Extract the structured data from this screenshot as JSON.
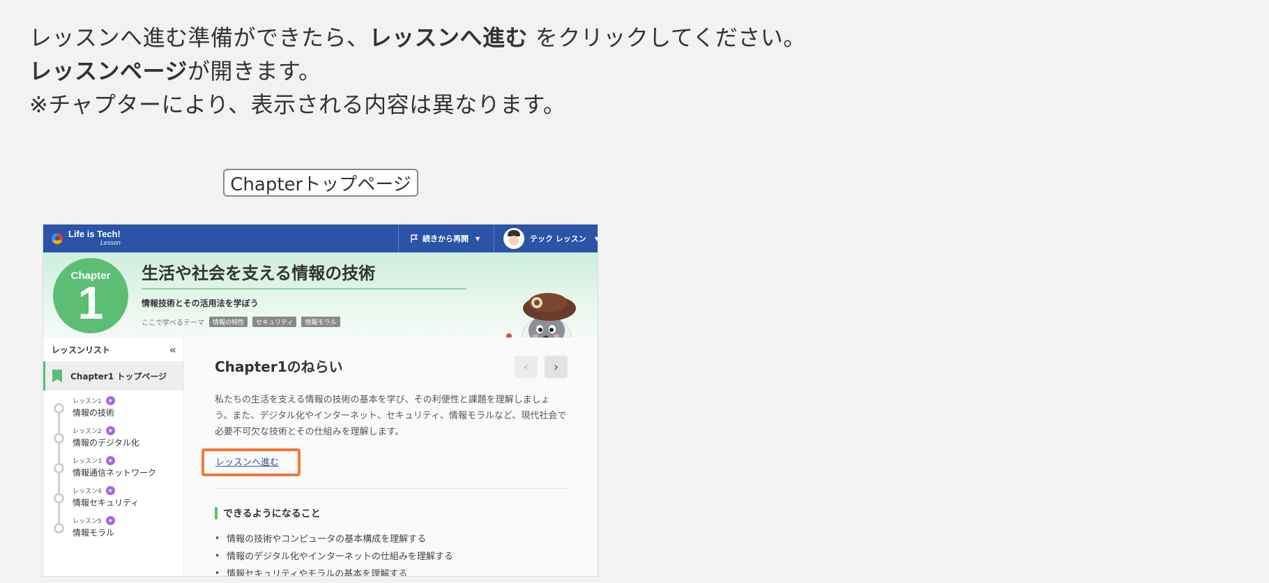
{
  "instructions": {
    "line1_pre": "レッスンへ進む準備ができたら、",
    "line1_bold": "レッスンへ進む",
    "line1_post": " をクリックしてください。",
    "line2_bold": "レッスンページ",
    "line2_post": "が開きます。",
    "line3": "※チャプターにより、表示される内容は異なります。"
  },
  "page_label": "Chapterトップページ",
  "app": {
    "logo_text": "Life is Tech!",
    "logo_sub": "Lesson",
    "resume_label": "続きから再開",
    "user_name": "テック レッスン"
  },
  "banner": {
    "chapter_word": "Chapter",
    "chapter_number": "1",
    "title": "生活や社会を支える情報の技術",
    "subtitle": "情報技術とその活用法を学ぼう",
    "themes_label": "ここで学べるテーマ",
    "themes": [
      "情報の特性",
      "セキュリティ",
      "情報モラル"
    ]
  },
  "sidebar": {
    "title": "レッスンリスト",
    "top_item": "Chapter1 トップページ",
    "lessons": [
      {
        "number": "レッスン1",
        "name": "情報の技術"
      },
      {
        "number": "レッスン2",
        "name": "情報のデジタル化"
      },
      {
        "number": "レッスン3",
        "name": "情報通信ネットワーク"
      },
      {
        "number": "レッスン4",
        "name": "情報セキュリティ"
      },
      {
        "number": "レッスン5",
        "name": "情報モラル"
      }
    ]
  },
  "main": {
    "aim_title": "Chapter1のねらい",
    "description": "私たちの生活を支える情報の技術の基本を学び、その利便性と課題を理解しましょう。また、デジタル化やインターネット、セキュリティ、情報モラルなど、現代社会で必要不可欠な技術とその仕組みを理解します。",
    "go_link": "レッスンへ進む",
    "can_title": "できるようになること",
    "goals": [
      "情報の技術やコンピュータの基本構成を理解する",
      "情報のデジタル化やインターネットの仕組みを理解する",
      "情報セキュリティやモラルの基本を理解する"
    ]
  },
  "colors": {
    "header_blue": "#2b54a7",
    "chapter_green": "#5cbe74",
    "highlight_orange": "#f07a32",
    "star_purple": "#a666d9"
  },
  "icons": [
    "flag-icon",
    "chevron-down-icon",
    "collapse-icon",
    "bookmark-icon",
    "star-icon",
    "chevron-left-icon",
    "chevron-right-icon"
  ]
}
